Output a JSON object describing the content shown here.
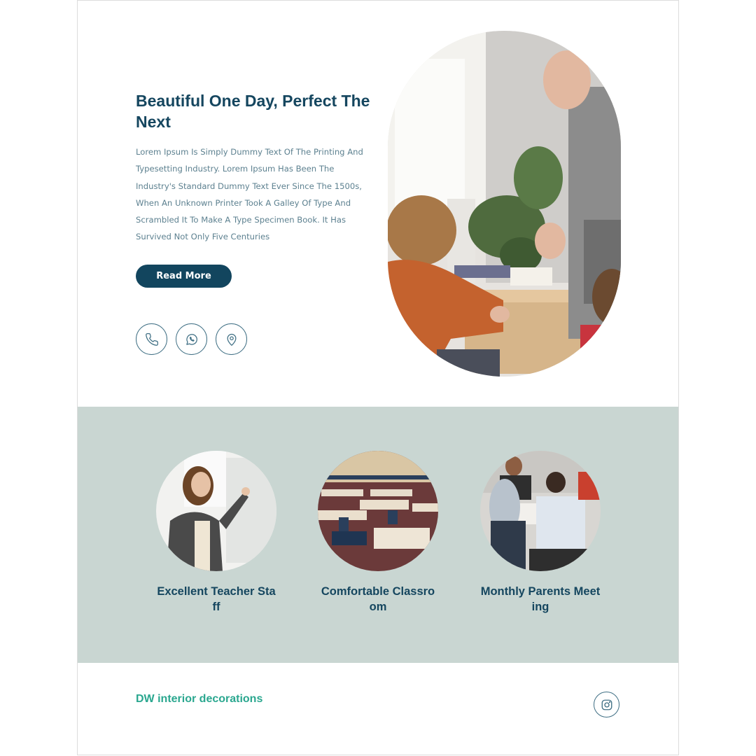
{
  "hero": {
    "title": "Beautiful One Day, Perfect The Next",
    "body": "Lorem Ipsum Is Simply Dummy Text Of The Printing And Typesetting Industry. Lorem Ipsum Has Been The Industry's Standard Dummy Text Ever Since The 1500s, When An Unknown Printer Took A Galley Of Type And Scrambled It To Make A Type Specimen Book. It Has Survived Not Only Five Centuries",
    "cta_label": "Read More",
    "contact_icons": [
      "phone-icon",
      "whatsapp-icon",
      "location-pin-icon"
    ]
  },
  "features": [
    {
      "label": "Excellent Teacher Staff"
    },
    {
      "label": "Comfortable Classroom"
    },
    {
      "label": "Monthly Parents Meeting"
    }
  ],
  "footer": {
    "brand": "DW interior decorations",
    "social_icon": "instagram-icon"
  },
  "colors": {
    "primary": "#12455e",
    "heading": "#15465f",
    "body_text": "#5d8190",
    "feature_band": "#c9d6d2",
    "brand_accent": "#2aa78f"
  }
}
